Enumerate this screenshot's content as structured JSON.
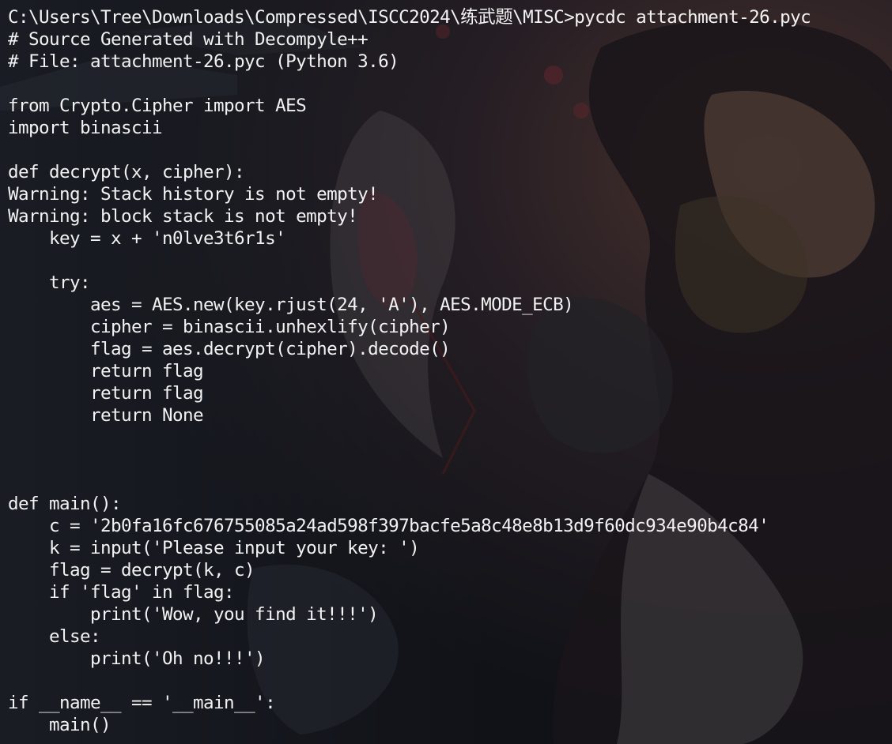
{
  "terminal": {
    "command": "C:\\Users\\Tree\\Downloads\\Compressed\\ISCC2024\\练武题\\MISC>pycdc attachment-26.pyc",
    "output": [
      "# Source Generated with Decompyle++",
      "# File: attachment-26.pyc (Python 3.6)",
      "",
      "from Crypto.Cipher import AES",
      "import binascii",
      "",
      "def decrypt(x, cipher):",
      "Warning: Stack history is not empty!",
      "Warning: block stack is not empty!",
      "    key = x + 'n0lve3t6r1s'",
      "",
      "    try:",
      "        aes = AES.new(key.rjust(24, 'A'), AES.MODE_ECB)",
      "        cipher = binascii.unhexlify(cipher)",
      "        flag = aes.decrypt(cipher).decode()",
      "        return flag",
      "        return flag",
      "        return None",
      "",
      "",
      "",
      "def main():",
      "    c = '2b0fa16fc676755085a24ad598f397bacfe5a8c48e8b13d9f60dc934e90b4c84'",
      "    k = input('Please input your key: ')",
      "    flag = decrypt(k, c)",
      "    if 'flag' in flag:",
      "        print('Wow, you find it!!!')",
      "    else:",
      "        print('Oh no!!!')",
      "",
      "if __name__ == '__main__':",
      "    main()"
    ]
  },
  "colors": {
    "text": "#f2f2f2",
    "background": "#1b1d24"
  }
}
